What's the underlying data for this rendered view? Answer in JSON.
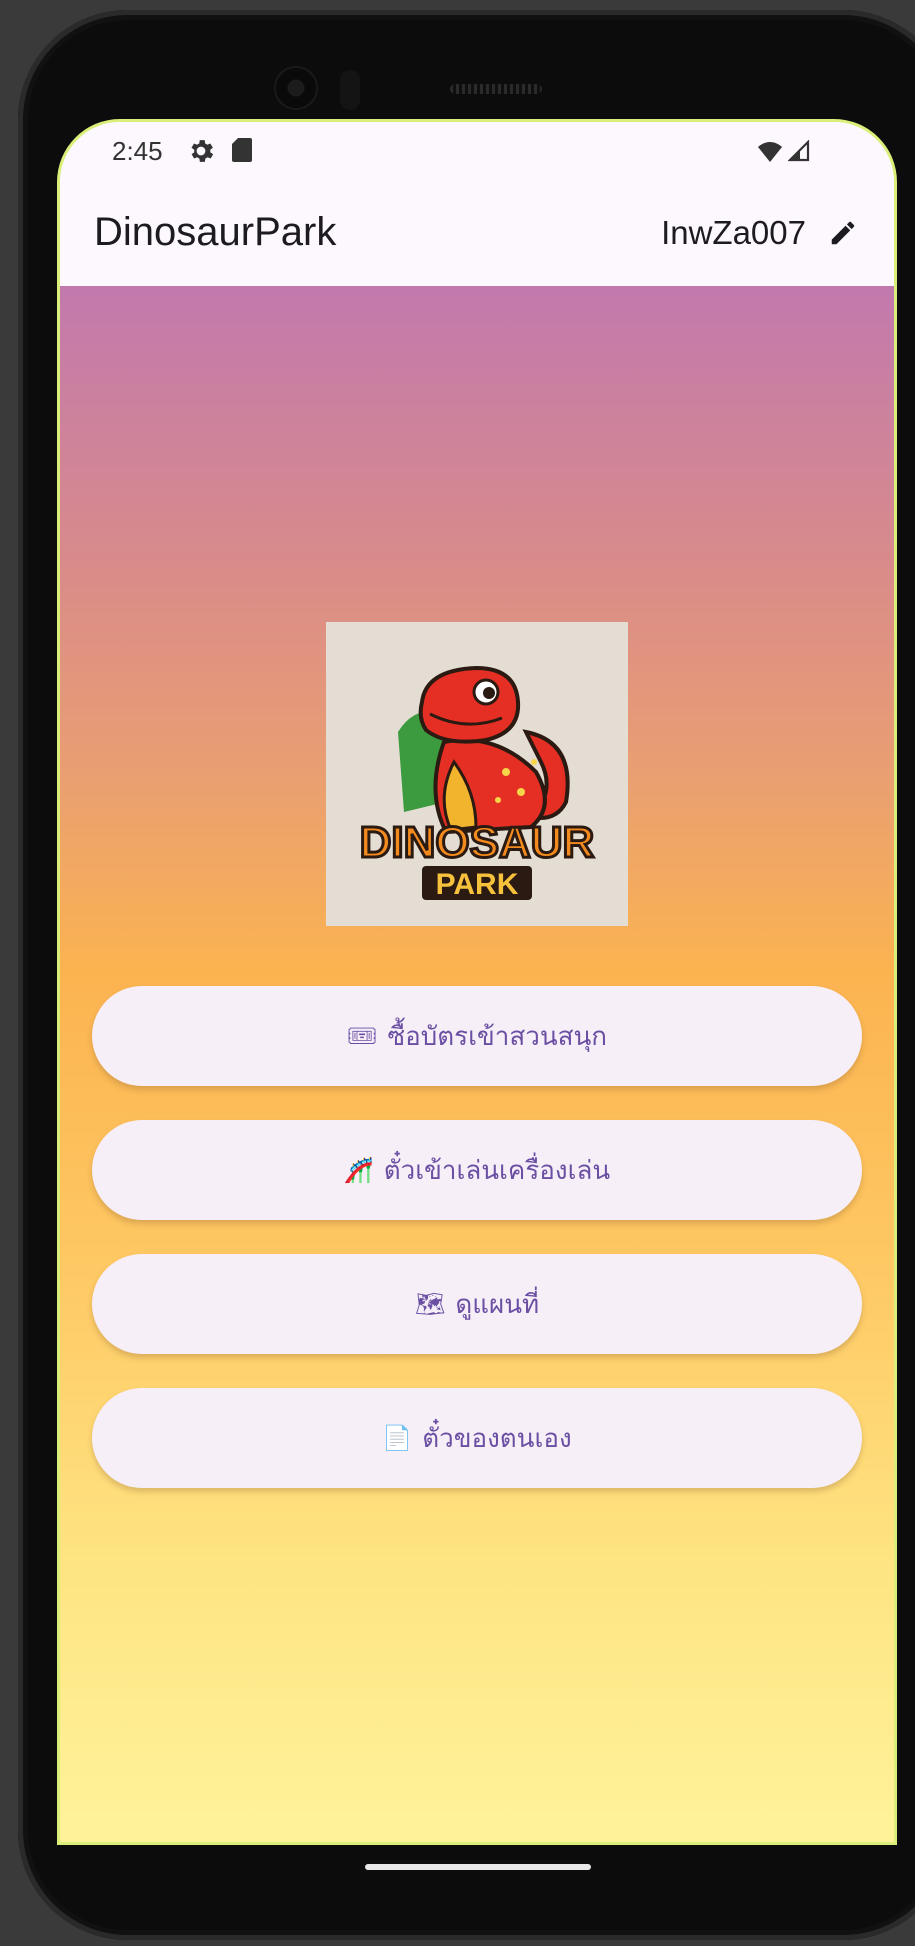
{
  "status_bar": {
    "time": "2:45"
  },
  "app_bar": {
    "title": "DinosaurPark",
    "user": "InwZa007"
  },
  "logo": {
    "line1": "DINOSAUR",
    "line2": "PARK"
  },
  "menu": [
    {
      "emoji": "🎟",
      "label": "ซื้อบัตรเข้าสวนสนุก"
    },
    {
      "emoji": "🎢",
      "label": "ตั๋วเข้าเล่นเครื่องเล่น"
    },
    {
      "emoji": "🗺",
      "label": "ดูแผนที่"
    },
    {
      "emoji": "📄",
      "label": "ตั๋วของตนเอง"
    }
  ],
  "colors": {
    "gradient_top": "#c279ad",
    "gradient_mid": "#fbb350",
    "gradient_bottom": "#fff39a",
    "button_bg": "#f6eff8",
    "button_text": "#6a4fa3",
    "app_bar_bg": "#fdf8fe"
  }
}
